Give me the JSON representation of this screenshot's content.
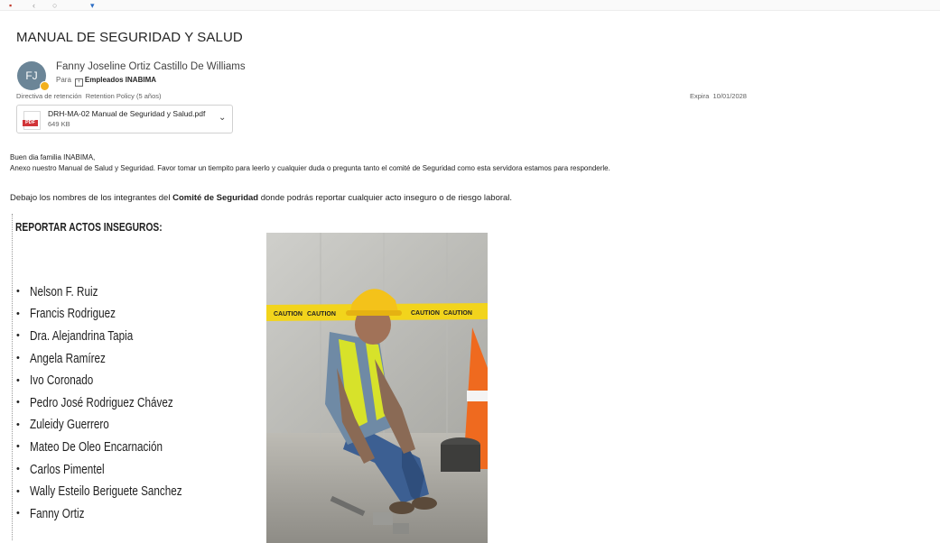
{
  "email": {
    "subject": "MANUAL DE SEGURIDAD Y SALUD",
    "sender": {
      "initials": "FJ",
      "name": "Fanny Joseline Ortiz Castillo De Williams",
      "to_label": "Para",
      "to_value": "Empleados INABIMA"
    },
    "retention": {
      "label": "Directiva de retención",
      "value": "Retention Policy (5 años)"
    },
    "expires": {
      "label": "Expira",
      "value": "10/01/2028"
    },
    "attachment": {
      "type_label": "PDF",
      "name": "DRH-MA-02 Manual de Seguridad y Salud.pdf",
      "size": "649 KB"
    },
    "body": {
      "greeting": "Buen dia familia INABIMA,",
      "line1": "Anexo nuestro Manual de Salud y Seguridad. Favor tomar un tiempito para leerlo y cualquier duda o pregunta tanto el comité de Seguridad como esta servidora estamos para responderle.",
      "line2_pre": "Debajo los nombres de los integrantes del ",
      "line2_bold": "Comité de Seguridad",
      "line2_post": " donde podrás reportar cualquier acto inseguro o de riesgo laboral.",
      "heading": "REPORTAR ACTOS INSEGUROS:",
      "members": [
        "Nelson F. Ruiz",
        "Francis Rodriguez",
        "Dra. Alejandrina Tapia",
        "Angela Ramírez",
        "Ivo Coronado",
        "Pedro José Rodriguez Chávez",
        "Zuleidy Guerrero",
        "Mateo De Oleo Encarnación",
        "Carlos Pimentel",
        "Wally Esteilo Beriguete Sanchez",
        "Fanny Ortiz"
      ],
      "bullet": "•",
      "tape_text": "CAUTION"
    }
  },
  "colors": {
    "avatar": "#6b8597",
    "pdf_red": "#d13438",
    "tape_yellow": "#f2d41c",
    "hard_hat": "#f4c21a"
  }
}
